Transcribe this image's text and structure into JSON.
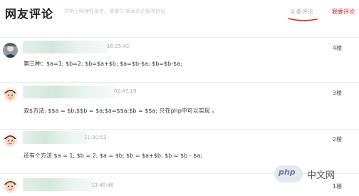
{
  "header": {
    "title": "网友评论",
    "subtitle": "文明上网理性发言，请遵守 新闻评论服务协议",
    "count_label": "4 条评论",
    "my_comment_label": "我要评论"
  },
  "comments": [
    {
      "time": "16:25:42",
      "floor": "4楼",
      "content": "第三种：$a=1; $b=2; $b=$a+$b; $a=$b-$a; $b=$b-$a;"
    },
    {
      "time": "02:47:19",
      "floor": "3楼",
      "content": "双$方法: $$a = $b;$$b = $a;$a=$$a;$b = $$a; 只在php中可以实现 。"
    },
    {
      "time": "11:30:53",
      "floor": "2楼",
      "content": "还有个方法 $a = 1; $b = 2; $a = $b; $b = $a+$b; $b = $b - $a;"
    },
    {
      "time": "13:48:46",
      "floor": "1楼",
      "content": ""
    }
  ],
  "watermark": {
    "logo_text": "php",
    "text": "中文网"
  },
  "colors": {
    "accent": "#e02020",
    "muted": "#a8a8a8"
  }
}
